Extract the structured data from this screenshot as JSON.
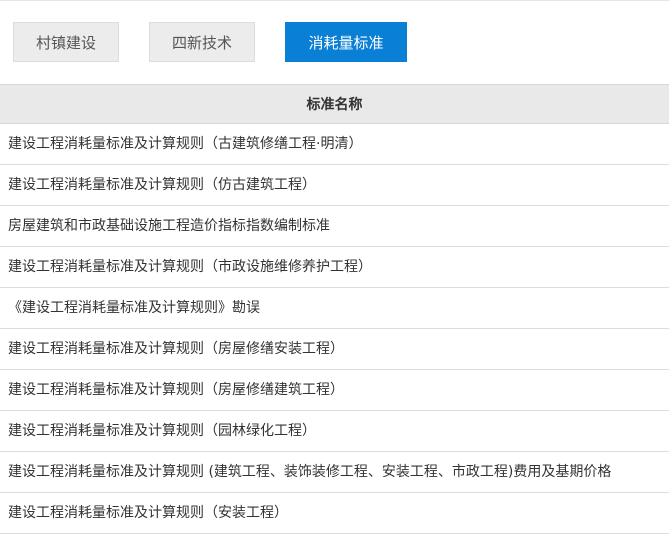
{
  "tabs": [
    {
      "label": "村镇建设",
      "active": false
    },
    {
      "label": "四新技术",
      "active": false
    },
    {
      "label": "消耗量标准",
      "active": true
    }
  ],
  "table": {
    "header": "标准名称",
    "rows": [
      "建设工程消耗量标准及计算规则（古建筑修缮工程·明清）",
      "建设工程消耗量标准及计算规则（仿古建筑工程）",
      "房屋建筑和市政基础设施工程造价指标指数编制标准",
      "建设工程消耗量标准及计算规则（市政设施维修养护工程）",
      "《建设工程消耗量标准及计算规则》勘误",
      "建设工程消耗量标准及计算规则（房屋修缮安装工程）",
      "建设工程消耗量标准及计算规则（房屋修缮建筑工程）",
      "建设工程消耗量标准及计算规则（园林绿化工程）",
      "建设工程消耗量标准及计算规则 (建筑工程、装饰装修工程、安装工程、市政工程)费用及基期价格",
      "建设工程消耗量标准及计算规则（安装工程）"
    ]
  },
  "colors": {
    "active_tab": "#0a7fd6",
    "inactive_tab": "#ececec",
    "header_bg": "#e9e9e9"
  }
}
